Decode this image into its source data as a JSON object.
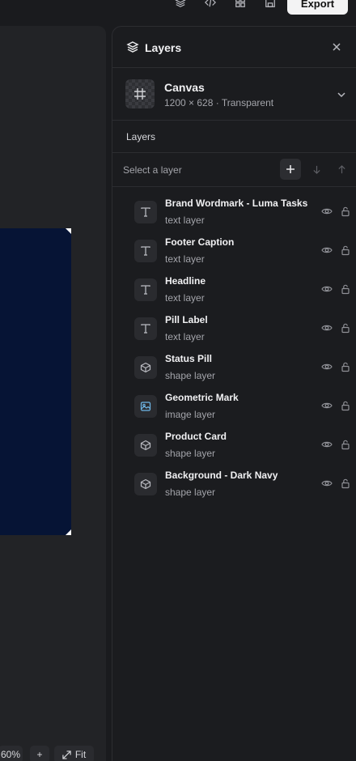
{
  "toolbar": {
    "export_label": "Export",
    "icons": [
      "layers-icon",
      "code-icon",
      "components-icon",
      "save-icon"
    ]
  },
  "zoom": {
    "level": "60%",
    "zoom_in_label": "+",
    "fit_label": "Fit"
  },
  "panel": {
    "title": "Layers",
    "canvas": {
      "name": "Canvas",
      "meta": "1200 × 628 · Transparent"
    },
    "section_label": "Layers",
    "select_placeholder": "Select a layer",
    "layers": [
      {
        "name": "Brand Wordmark - Luma Tasks",
        "type": "text layer",
        "icon": "text-icon"
      },
      {
        "name": "Footer Caption",
        "type": "text layer",
        "icon": "text-icon"
      },
      {
        "name": "Headline",
        "type": "text layer",
        "icon": "text-icon"
      },
      {
        "name": "Pill Label",
        "type": "text layer",
        "icon": "text-icon"
      },
      {
        "name": "Status Pill",
        "type": "shape layer",
        "icon": "shape-icon"
      },
      {
        "name": "Geometric Mark",
        "type": "image layer",
        "icon": "image-icon"
      },
      {
        "name": "Product Card",
        "type": "shape layer",
        "icon": "shape-icon"
      },
      {
        "name": "Background - Dark Navy",
        "type": "shape layer",
        "icon": "shape-icon"
      }
    ]
  },
  "colors": {
    "artboard": "#061435",
    "panel_bg": "#1b1c1f",
    "accent_image_icon": "#6fb7e8"
  }
}
